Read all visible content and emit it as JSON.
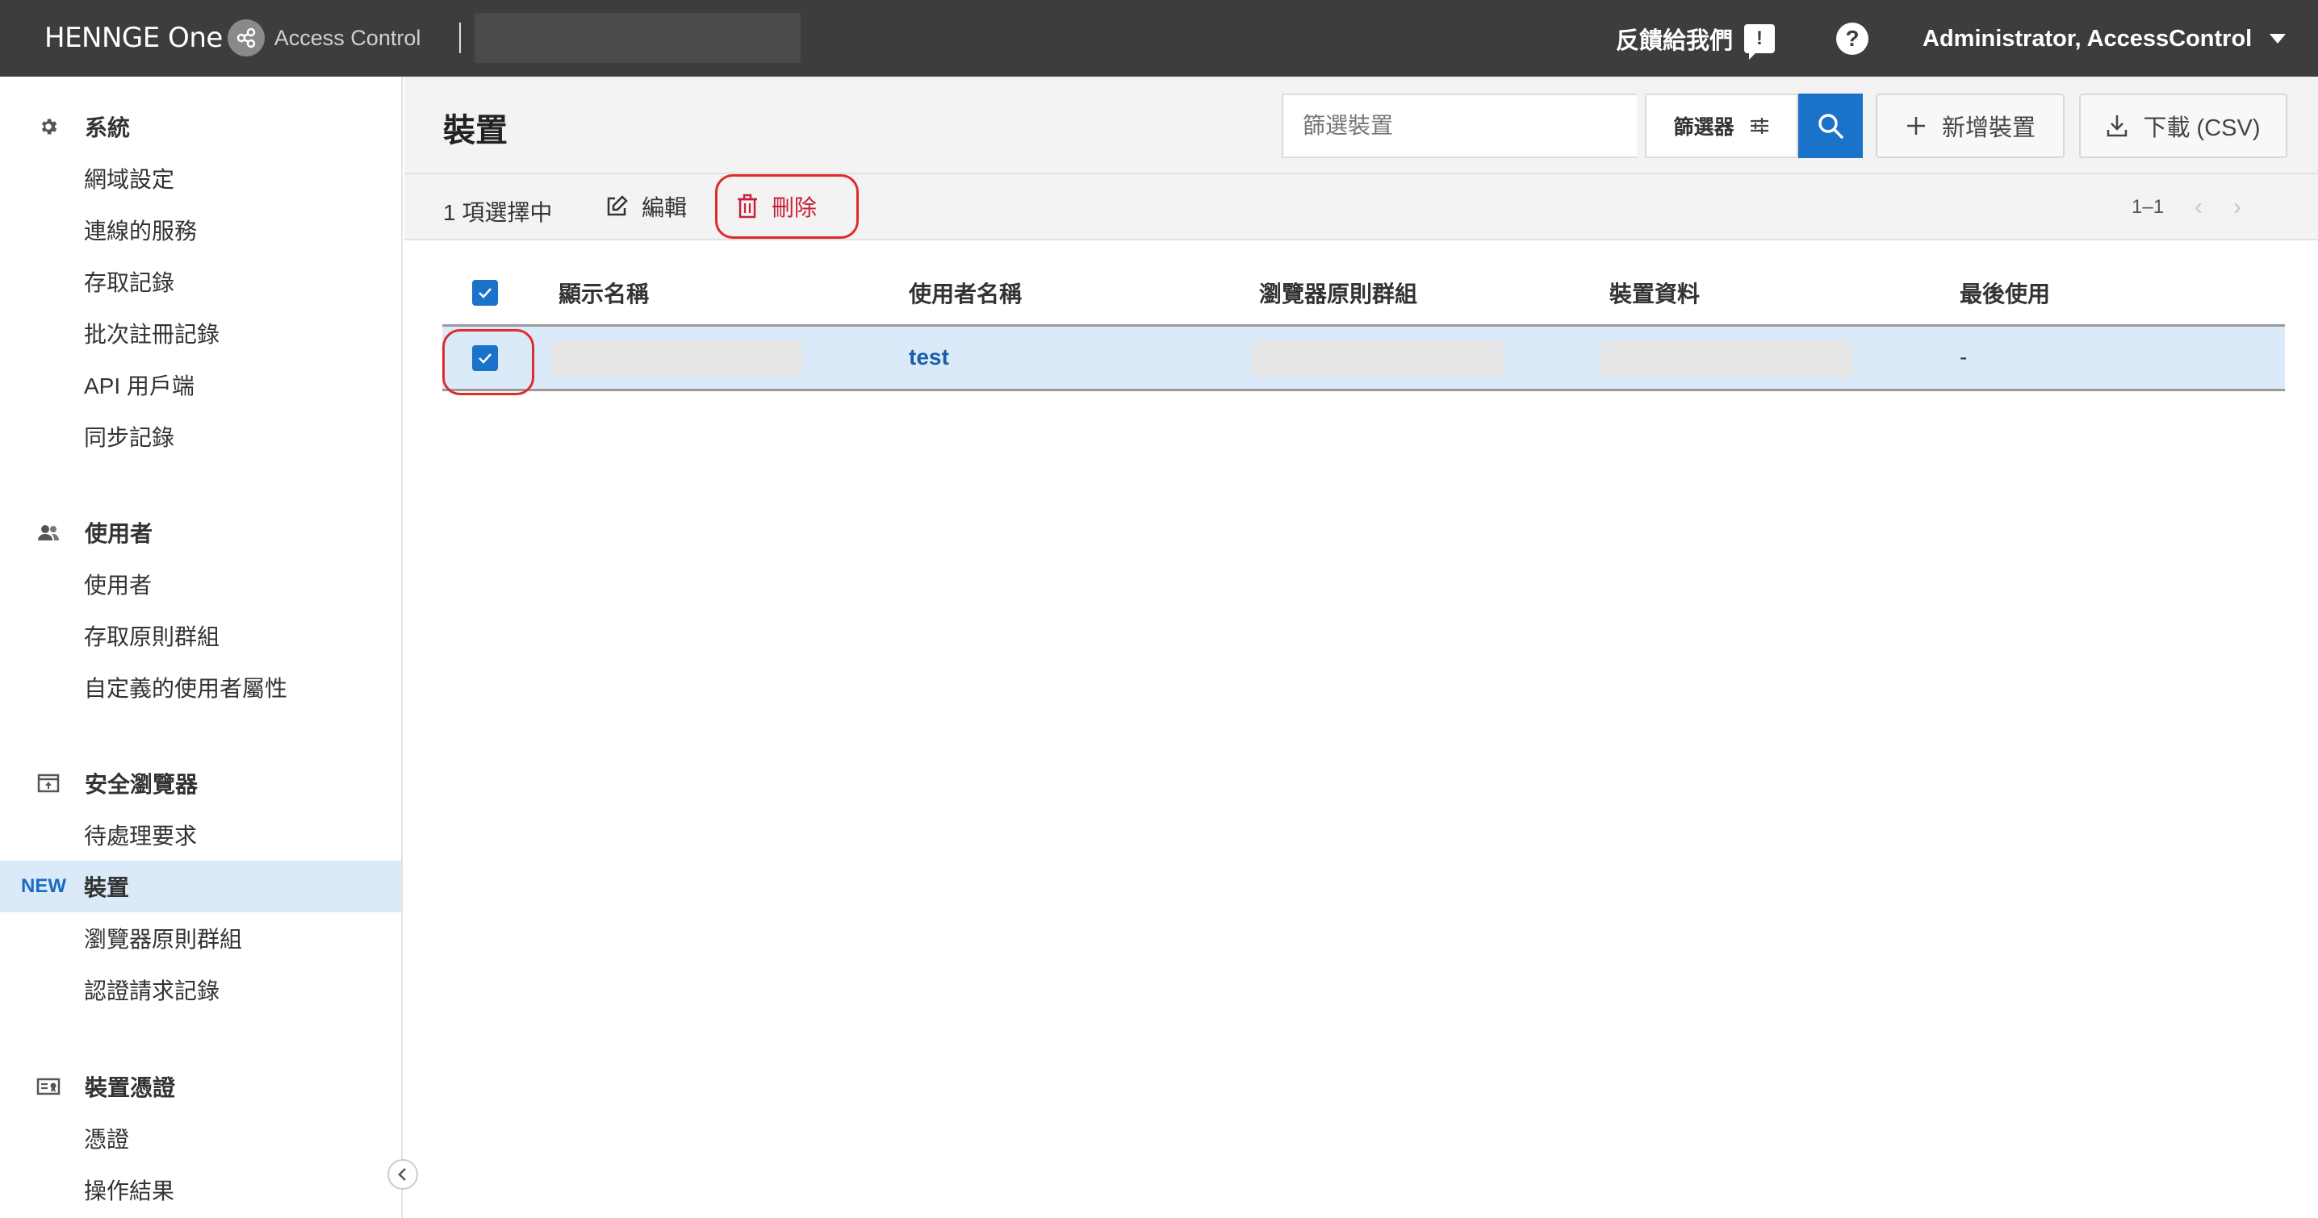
{
  "topbar": {
    "brand": "HENNGE One",
    "product": "Access Control",
    "feedback_label": "反饋給我們",
    "feedback_icon": "feedback-icon",
    "help_icon_glyph": "?",
    "account_label": "Administrator, AccessControl"
  },
  "sidebar": {
    "sections": [
      {
        "title": "系統",
        "icon": "gear-icon",
        "items": [
          "網域設定",
          "連線的服務",
          "存取記錄",
          "批次註冊記錄",
          "API 用戶端",
          "同步記錄"
        ]
      },
      {
        "title": "使用者",
        "icon": "users-icon",
        "items": [
          "使用者",
          "存取原則群組",
          "自定義的使用者屬性"
        ]
      },
      {
        "title": "安全瀏覽器",
        "icon": "browser-icon",
        "items": [
          "待處理要求",
          "裝置",
          "瀏覽器原則群組",
          "認證請求記錄"
        ]
      },
      {
        "title": "裝置憑證",
        "icon": "certificate-icon",
        "items": [
          "憑證",
          "操作結果"
        ]
      }
    ],
    "new_tag": "NEW",
    "active_item": "裝置"
  },
  "page": {
    "title": "裝置",
    "search_placeholder": "篩選裝置",
    "filter_label": "篩選器",
    "add_button": "新增裝置",
    "download_button": "下載 (CSV)"
  },
  "action_bar": {
    "selected_count": "1 項選擇中",
    "edit_label": "編輯",
    "delete_label": "刪除",
    "pagination": "1–1"
  },
  "table": {
    "headers": [
      "顯示名稱",
      "使用者名稱",
      "瀏覽器原則群組",
      "裝置資料",
      "最後使用"
    ],
    "rows": [
      {
        "checked": true,
        "display_name": "",
        "username": "test",
        "browser_policy_group": "",
        "device_data": "",
        "last_used": "-"
      }
    ]
  },
  "colors": {
    "topbar": "#3d3d3d",
    "accent": "#1a72c9",
    "selected_row": "#dbeaf8",
    "danger": "#c8203a",
    "annotation": "#e02b2b"
  }
}
